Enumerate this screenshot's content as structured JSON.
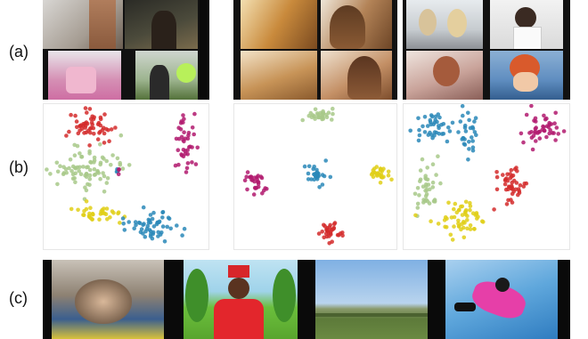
{
  "figure": {
    "row_labels": {
      "a": "(a)",
      "b": "(b)",
      "c": "(c)"
    }
  },
  "palette": {
    "red": "#d42c2c",
    "magenta": "#b21a6e",
    "green": "#a8c98a",
    "yellow": "#e0cf18",
    "blue": "#2a88b8"
  }
}
